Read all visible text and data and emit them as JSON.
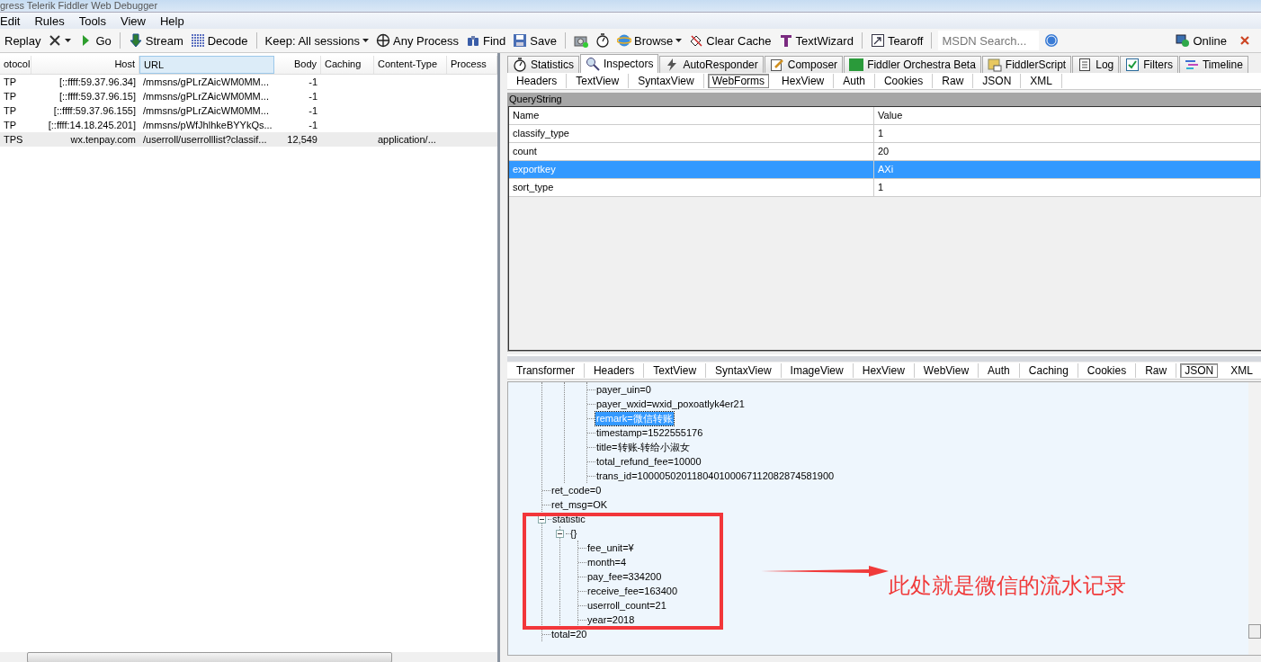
{
  "window": {
    "title": "gress Telerik Fiddler Web Debugger"
  },
  "menu": [
    "Edit",
    "Rules",
    "Tools",
    "View",
    "Help"
  ],
  "toolbar": [
    {
      "kind": "button",
      "label": "Replay"
    },
    {
      "kind": "dropdown"
    },
    {
      "kind": "button",
      "label": "Go"
    },
    {
      "kind": "sep"
    },
    {
      "kind": "button",
      "label": "Stream"
    },
    {
      "kind": "button",
      "label": "Decode"
    },
    {
      "kind": "sep"
    },
    {
      "kind": "dropdown",
      "label": "Keep: All sessions"
    },
    {
      "kind": "button",
      "label": "Any Process"
    },
    {
      "kind": "button",
      "label": "Find"
    },
    {
      "kind": "button",
      "label": "Save"
    },
    {
      "kind": "sep"
    },
    {
      "kind": "button"
    },
    {
      "kind": "button"
    },
    {
      "kind": "dropdown",
      "label": "Browse"
    },
    {
      "kind": "button",
      "label": "Clear Cache"
    },
    {
      "kind": "button",
      "label": "TextWizard"
    },
    {
      "kind": "sep"
    },
    {
      "kind": "button",
      "label": "Tearoff"
    },
    {
      "kind": "sep"
    },
    {
      "kind": "search",
      "placeholder": "MSDN Search..."
    },
    {
      "kind": "button"
    }
  ],
  "online": {
    "label": "Online"
  },
  "sessions": {
    "columns": [
      "otocol",
      "Host",
      "URL",
      "Body",
      "Caching",
      "Content-Type",
      "Process"
    ],
    "rows": [
      {
        "protocol": "TP",
        "host": "[::ffff:59.37.96.34]",
        "url": "/mmsns/gPLrZAicWM0MM...",
        "body": "-1",
        "selected": false
      },
      {
        "protocol": "TP",
        "host": "[::ffff:59.37.96.15]",
        "url": "/mmsns/gPLrZAicWM0MM...",
        "body": "-1",
        "selected": false
      },
      {
        "protocol": "TP",
        "host": "[::ffff:59.37.96.155]",
        "url": "/mmsns/gPLrZAicWM0MM...",
        "body": "-1",
        "selected": false
      },
      {
        "protocol": "TP",
        "host": "[::ffff:14.18.245.201]",
        "url": "/mmsns/pWfJhlhkeBYYkQs...",
        "body": "-1",
        "selected": false
      },
      {
        "protocol": "TPS",
        "host": "wx.tenpay.com",
        "url": "/userroll/userrolllist?classif...",
        "body": "12,549",
        "content_type": "application/...",
        "selected": true
      }
    ]
  },
  "main_tabs": [
    {
      "label": "Statistics",
      "selected": false
    },
    {
      "label": "Inspectors",
      "selected": true
    },
    {
      "label": "AutoResponder",
      "selected": false
    },
    {
      "label": "Composer",
      "selected": false
    },
    {
      "label": "Fiddler Orchestra Beta",
      "selected": false
    },
    {
      "label": "FiddlerScript",
      "selected": false
    },
    {
      "label": "Log",
      "selected": false
    },
    {
      "label": "Filters",
      "selected": false
    },
    {
      "label": "Timeline",
      "selected": false
    }
  ],
  "request_tabs": [
    {
      "label": "Headers",
      "selected": false
    },
    {
      "label": "TextView",
      "selected": false
    },
    {
      "label": "SyntaxView",
      "selected": false
    },
    {
      "label": "WebForms",
      "selected": true
    },
    {
      "label": "HexView",
      "selected": false
    },
    {
      "label": "Auth",
      "selected": false
    },
    {
      "label": "Cookies",
      "selected": false
    },
    {
      "label": "Raw",
      "selected": false
    },
    {
      "label": "JSON",
      "selected": false
    },
    {
      "label": "XML",
      "selected": false
    }
  ],
  "querystring": {
    "title": "QueryString",
    "columns": [
      "Name",
      "Value"
    ],
    "rows": [
      {
        "name": "classify_type",
        "value": "1",
        "selected": false
      },
      {
        "name": "count",
        "value": "20",
        "selected": false
      },
      {
        "name": "exportkey",
        "value": "AXi",
        "selected": true
      },
      {
        "name": "sort_type",
        "value": "1",
        "selected": false
      }
    ]
  },
  "response_tabs": [
    {
      "label": "Transformer",
      "selected": false
    },
    {
      "label": "Headers",
      "selected": false
    },
    {
      "label": "TextView",
      "selected": false
    },
    {
      "label": "SyntaxView",
      "selected": false
    },
    {
      "label": "ImageView",
      "selected": false
    },
    {
      "label": "HexView",
      "selected": false
    },
    {
      "label": "WebView",
      "selected": false
    },
    {
      "label": "Auth",
      "selected": false
    },
    {
      "label": "Caching",
      "selected": false
    },
    {
      "label": "Cookies",
      "selected": false
    },
    {
      "label": "Raw",
      "selected": false
    },
    {
      "label": "JSON",
      "selected": true
    },
    {
      "label": "XML",
      "selected": false
    }
  ],
  "tree": [
    {
      "children": [
        {
          "children": [
            {
              "text": "payer_uin=0",
              "selected": false
            },
            {
              "text": "payer_wxid=wxid_poxoatlyk4er21",
              "selected": false
            },
            {
              "text": "remark=微信转账",
              "selected": true
            },
            {
              "text": "timestamp=1522555176",
              "selected": false
            },
            {
              "text": "title=转账-转给小淑女",
              "selected": false
            },
            {
              "text": "total_refund_fee=10000",
              "selected": false
            },
            {
              "text": "trans_id=100005020118040100067112082874581900",
              "selected": false
            }
          ]
        }
      ]
    },
    {
      "text": "ret_code=0",
      "selected": false
    },
    {
      "text": "ret_msg=OK",
      "selected": false
    },
    {
      "text": "statistic",
      "selected": false,
      "expanded": true,
      "children": [
        {
          "text": "{}",
          "selected": false,
          "expanded": true,
          "children": [
            {
              "text": "fee_unit=¥",
              "selected": false
            },
            {
              "text": "month=4",
              "selected": false
            },
            {
              "text": "pay_fee=334200",
              "selected": false
            },
            {
              "text": "receive_fee=163400",
              "selected": false
            },
            {
              "text": "userroll_count=21",
              "selected": false
            },
            {
              "text": "year=2018",
              "selected": false
            }
          ]
        }
      ]
    },
    {
      "text": "total=20",
      "selected": false
    }
  ],
  "annotation": {
    "text": "此处就是微信的流水记录"
  }
}
